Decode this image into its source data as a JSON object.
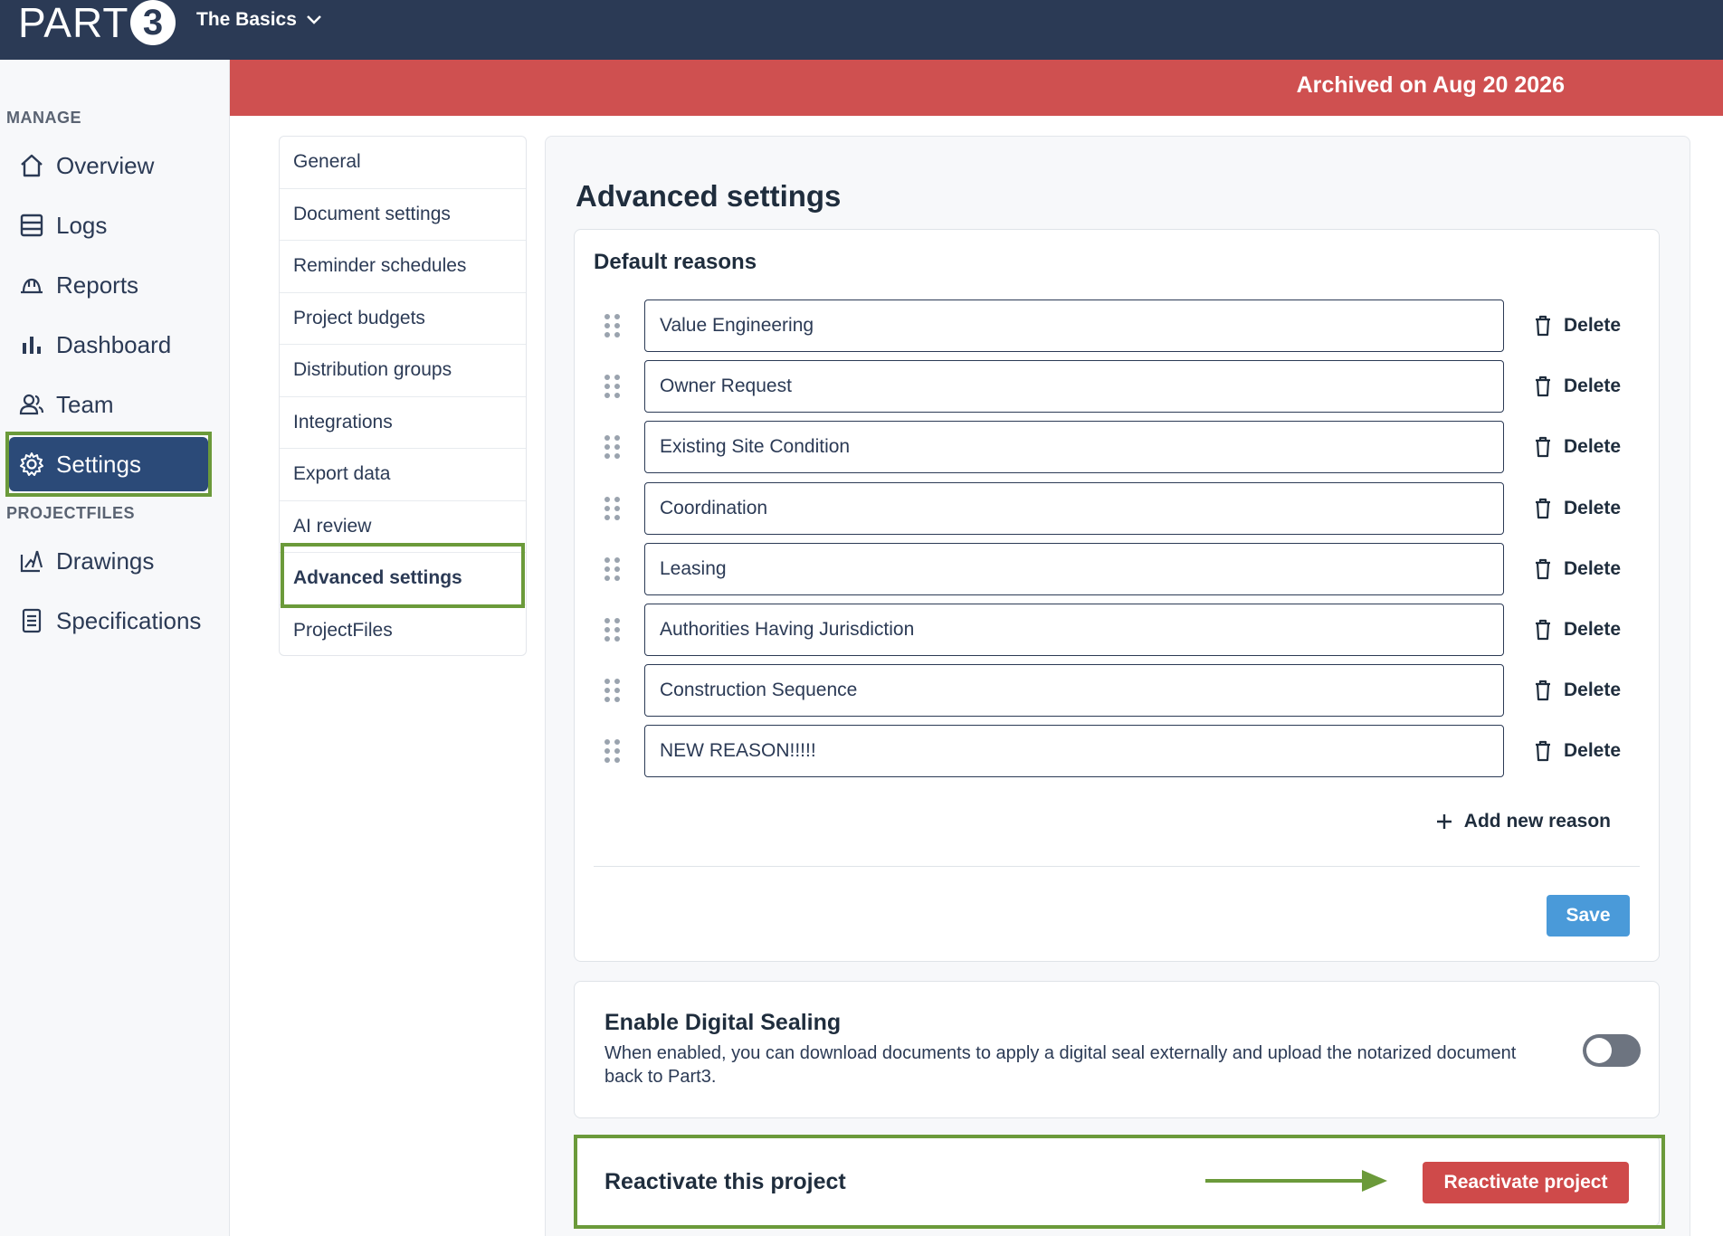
{
  "app": {
    "logo_text": "PART",
    "logo_number": "3",
    "project_name": "The Basics"
  },
  "banner": {
    "text": "Archived on Aug 20 2026"
  },
  "sidebar": {
    "sections": [
      {
        "label": "MANAGE",
        "items": [
          {
            "label": "Overview",
            "icon": "home-icon"
          },
          {
            "label": "Logs",
            "icon": "logs-icon"
          },
          {
            "label": "Reports",
            "icon": "hardhat-icon"
          },
          {
            "label": "Dashboard",
            "icon": "bar-chart-icon"
          },
          {
            "label": "Team",
            "icon": "team-icon"
          },
          {
            "label": "Settings",
            "icon": "gear-icon",
            "active": true
          }
        ]
      },
      {
        "label": "PROJECTFILES",
        "items": [
          {
            "label": "Drawings",
            "icon": "drawings-icon"
          },
          {
            "label": "Specifications",
            "icon": "document-icon"
          }
        ]
      }
    ]
  },
  "settings_nav": {
    "items": [
      "General",
      "Document settings",
      "Reminder schedules",
      "Project budgets",
      "Distribution groups",
      "Integrations",
      "Export data",
      "AI review",
      "Advanced settings",
      "ProjectFiles"
    ],
    "active": "Advanced settings"
  },
  "main": {
    "title": "Advanced settings",
    "default_reasons": {
      "title": "Default reasons",
      "reasons": [
        "Value Engineering",
        "Owner Request",
        "Existing Site Condition",
        "Coordination",
        "Leasing",
        "Authorities Having Jurisdiction",
        "Construction Sequence",
        "NEW REASON!!!!!"
      ],
      "delete_label": "Delete",
      "add_label": "Add new reason",
      "save_label": "Save"
    },
    "digital_sealing": {
      "title": "Enable Digital Sealing",
      "description": "When enabled, you can download documents to apply a digital seal externally and upload the notarized document back to Part3.",
      "enabled": false
    },
    "reactivate": {
      "title": "Reactivate this project",
      "button_label": "Reactivate project"
    }
  },
  "colors": {
    "topbar": "#2b3a55",
    "banner": "#cf5050",
    "highlight": "#6b9a3a",
    "save_button": "#4a9ad9",
    "reactivate_button": "#cf4a4a"
  }
}
